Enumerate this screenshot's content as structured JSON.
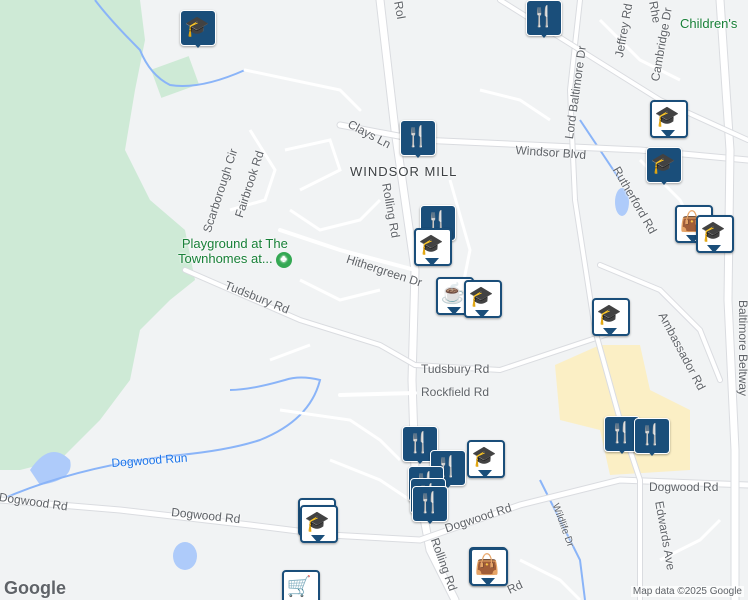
{
  "map": {
    "colors": {
      "land": "#f1f3f4",
      "park": "#ceead6",
      "water": "#aecbfa",
      "road": "#ffffff",
      "road_outline": "#dadce0",
      "campus": "#fbefc5",
      "pin_fill": "#1a4e7a"
    },
    "labels": {
      "windsor_mill": "WINDSOR MILL",
      "windsor_blvd": "Windsor Blvd",
      "clays_ln": "Clays Ln",
      "rolling_rd_north": "Rolling Rd",
      "rolling_rd_south": "Rolling Rd",
      "hithergreen_dr": "Hithergreen Dr",
      "tudsbury_rd_west": "Tudsbury Rd",
      "tudsbury_rd_east": "Tudsbury Rd",
      "rockfield_rd": "Rockfield Rd",
      "dogwood_run": "Dogwood Run",
      "dogwood_rd_west": "Dogwood Rd",
      "dogwood_rd_mid": "Dogwood Rd",
      "dogwood_rd_east": "Dogwood Rd",
      "dogwood_rd_far_east": "Dogwood Rd",
      "scarborough_cir": "Scarborough Cir",
      "fairbrook_rd": "Fairbrook Rd",
      "lord_baltimore_dr": "Lord Baltimore Dr",
      "rutherford_rd": "Rutherford Rd",
      "ambassador_rd": "Ambassador Rd",
      "baltimore_beltway": "Baltimore Beltway",
      "edwards_ave": "Edwards Ave",
      "wildlife_dr": "Wildlife Dr",
      "jeffrey_rd": "Jeffrey Rd",
      "cambridge_dr": "Cambridge Dr",
      "rhea_top": "Rhe",
      "rol_top": "Rol",
      "childrens": "Children's",
      "playground": "Playground at The\nTownhomes at...",
      "rd_partial_bottom": "Rd"
    },
    "pins": [
      {
        "icon": "school-icon",
        "glyph": "🎓"
      },
      {
        "icon": "restaurant-icon",
        "glyph": "🍴"
      },
      {
        "icon": "school-icon",
        "glyph": "🎓"
      },
      {
        "icon": "school-icon",
        "glyph": "🎓"
      },
      {
        "icon": "restaurant-icon",
        "glyph": "🍴"
      },
      {
        "icon": "shopping-bag-icon",
        "glyph": "👜"
      },
      {
        "icon": "school-icon",
        "glyph": "🎓"
      },
      {
        "icon": "cafe-icon",
        "glyph": "☕"
      },
      {
        "icon": "school-icon",
        "glyph": "🎓"
      },
      {
        "icon": "school-icon",
        "glyph": "🎓"
      },
      {
        "icon": "shopping-bag-icon",
        "glyph": "👜"
      },
      {
        "icon": "school-icon",
        "glyph": "🎓"
      },
      {
        "icon": "school-icon",
        "glyph": "🎓"
      },
      {
        "icon": "restaurant-icon",
        "glyph": "🍴"
      },
      {
        "icon": "restaurant-icon",
        "glyph": "🍴"
      },
      {
        "icon": "restaurant-icon",
        "glyph": "🍴"
      },
      {
        "icon": "restaurant-icon",
        "glyph": "🍴"
      },
      {
        "icon": "restaurant-icon",
        "glyph": "🍴"
      },
      {
        "icon": "school-icon",
        "glyph": "🎓"
      },
      {
        "icon": "restaurant-icon",
        "glyph": "🍴"
      },
      {
        "icon": "restaurant-icon",
        "glyph": "🍴"
      },
      {
        "icon": "school-icon",
        "glyph": "🎓"
      },
      {
        "icon": "shopping-bag-icon",
        "glyph": "👜"
      },
      {
        "icon": "grocery-cart-icon",
        "glyph": "🛒"
      },
      {
        "icon": "restaurant-icon",
        "glyph": "🍴"
      }
    ],
    "branding": {
      "logo": "Google",
      "attribution": "Map data ©2025 Google"
    }
  }
}
